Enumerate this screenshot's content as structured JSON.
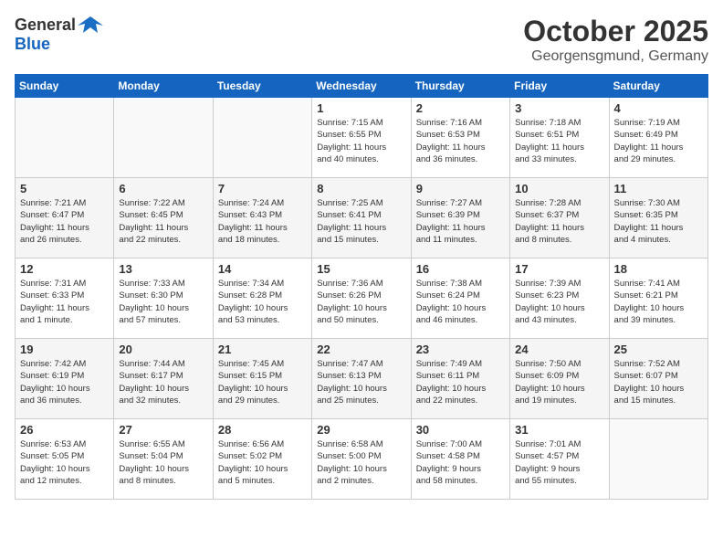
{
  "header": {
    "logo_general": "General",
    "logo_blue": "Blue",
    "month": "October 2025",
    "location": "Georgensgmund, Germany"
  },
  "weekdays": [
    "Sunday",
    "Monday",
    "Tuesday",
    "Wednesday",
    "Thursday",
    "Friday",
    "Saturday"
  ],
  "weeks": [
    [
      {
        "day": "",
        "info": ""
      },
      {
        "day": "",
        "info": ""
      },
      {
        "day": "",
        "info": ""
      },
      {
        "day": "1",
        "info": "Sunrise: 7:15 AM\nSunset: 6:55 PM\nDaylight: 11 hours\nand 40 minutes."
      },
      {
        "day": "2",
        "info": "Sunrise: 7:16 AM\nSunset: 6:53 PM\nDaylight: 11 hours\nand 36 minutes."
      },
      {
        "day": "3",
        "info": "Sunrise: 7:18 AM\nSunset: 6:51 PM\nDaylight: 11 hours\nand 33 minutes."
      },
      {
        "day": "4",
        "info": "Sunrise: 7:19 AM\nSunset: 6:49 PM\nDaylight: 11 hours\nand 29 minutes."
      }
    ],
    [
      {
        "day": "5",
        "info": "Sunrise: 7:21 AM\nSunset: 6:47 PM\nDaylight: 11 hours\nand 26 minutes."
      },
      {
        "day": "6",
        "info": "Sunrise: 7:22 AM\nSunset: 6:45 PM\nDaylight: 11 hours\nand 22 minutes."
      },
      {
        "day": "7",
        "info": "Sunrise: 7:24 AM\nSunset: 6:43 PM\nDaylight: 11 hours\nand 18 minutes."
      },
      {
        "day": "8",
        "info": "Sunrise: 7:25 AM\nSunset: 6:41 PM\nDaylight: 11 hours\nand 15 minutes."
      },
      {
        "day": "9",
        "info": "Sunrise: 7:27 AM\nSunset: 6:39 PM\nDaylight: 11 hours\nand 11 minutes."
      },
      {
        "day": "10",
        "info": "Sunrise: 7:28 AM\nSunset: 6:37 PM\nDaylight: 11 hours\nand 8 minutes."
      },
      {
        "day": "11",
        "info": "Sunrise: 7:30 AM\nSunset: 6:35 PM\nDaylight: 11 hours\nand 4 minutes."
      }
    ],
    [
      {
        "day": "12",
        "info": "Sunrise: 7:31 AM\nSunset: 6:33 PM\nDaylight: 11 hours\nand 1 minute."
      },
      {
        "day": "13",
        "info": "Sunrise: 7:33 AM\nSunset: 6:30 PM\nDaylight: 10 hours\nand 57 minutes."
      },
      {
        "day": "14",
        "info": "Sunrise: 7:34 AM\nSunset: 6:28 PM\nDaylight: 10 hours\nand 53 minutes."
      },
      {
        "day": "15",
        "info": "Sunrise: 7:36 AM\nSunset: 6:26 PM\nDaylight: 10 hours\nand 50 minutes."
      },
      {
        "day": "16",
        "info": "Sunrise: 7:38 AM\nSunset: 6:24 PM\nDaylight: 10 hours\nand 46 minutes."
      },
      {
        "day": "17",
        "info": "Sunrise: 7:39 AM\nSunset: 6:23 PM\nDaylight: 10 hours\nand 43 minutes."
      },
      {
        "day": "18",
        "info": "Sunrise: 7:41 AM\nSunset: 6:21 PM\nDaylight: 10 hours\nand 39 minutes."
      }
    ],
    [
      {
        "day": "19",
        "info": "Sunrise: 7:42 AM\nSunset: 6:19 PM\nDaylight: 10 hours\nand 36 minutes."
      },
      {
        "day": "20",
        "info": "Sunrise: 7:44 AM\nSunset: 6:17 PM\nDaylight: 10 hours\nand 32 minutes."
      },
      {
        "day": "21",
        "info": "Sunrise: 7:45 AM\nSunset: 6:15 PM\nDaylight: 10 hours\nand 29 minutes."
      },
      {
        "day": "22",
        "info": "Sunrise: 7:47 AM\nSunset: 6:13 PM\nDaylight: 10 hours\nand 25 minutes."
      },
      {
        "day": "23",
        "info": "Sunrise: 7:49 AM\nSunset: 6:11 PM\nDaylight: 10 hours\nand 22 minutes."
      },
      {
        "day": "24",
        "info": "Sunrise: 7:50 AM\nSunset: 6:09 PM\nDaylight: 10 hours\nand 19 minutes."
      },
      {
        "day": "25",
        "info": "Sunrise: 7:52 AM\nSunset: 6:07 PM\nDaylight: 10 hours\nand 15 minutes."
      }
    ],
    [
      {
        "day": "26",
        "info": "Sunrise: 6:53 AM\nSunset: 5:05 PM\nDaylight: 10 hours\nand 12 minutes."
      },
      {
        "day": "27",
        "info": "Sunrise: 6:55 AM\nSunset: 5:04 PM\nDaylight: 10 hours\nand 8 minutes."
      },
      {
        "day": "28",
        "info": "Sunrise: 6:56 AM\nSunset: 5:02 PM\nDaylight: 10 hours\nand 5 minutes."
      },
      {
        "day": "29",
        "info": "Sunrise: 6:58 AM\nSunset: 5:00 PM\nDaylight: 10 hours\nand 2 minutes."
      },
      {
        "day": "30",
        "info": "Sunrise: 7:00 AM\nSunset: 4:58 PM\nDaylight: 9 hours\nand 58 minutes."
      },
      {
        "day": "31",
        "info": "Sunrise: 7:01 AM\nSunset: 4:57 PM\nDaylight: 9 hours\nand 55 minutes."
      },
      {
        "day": "",
        "info": ""
      }
    ]
  ]
}
